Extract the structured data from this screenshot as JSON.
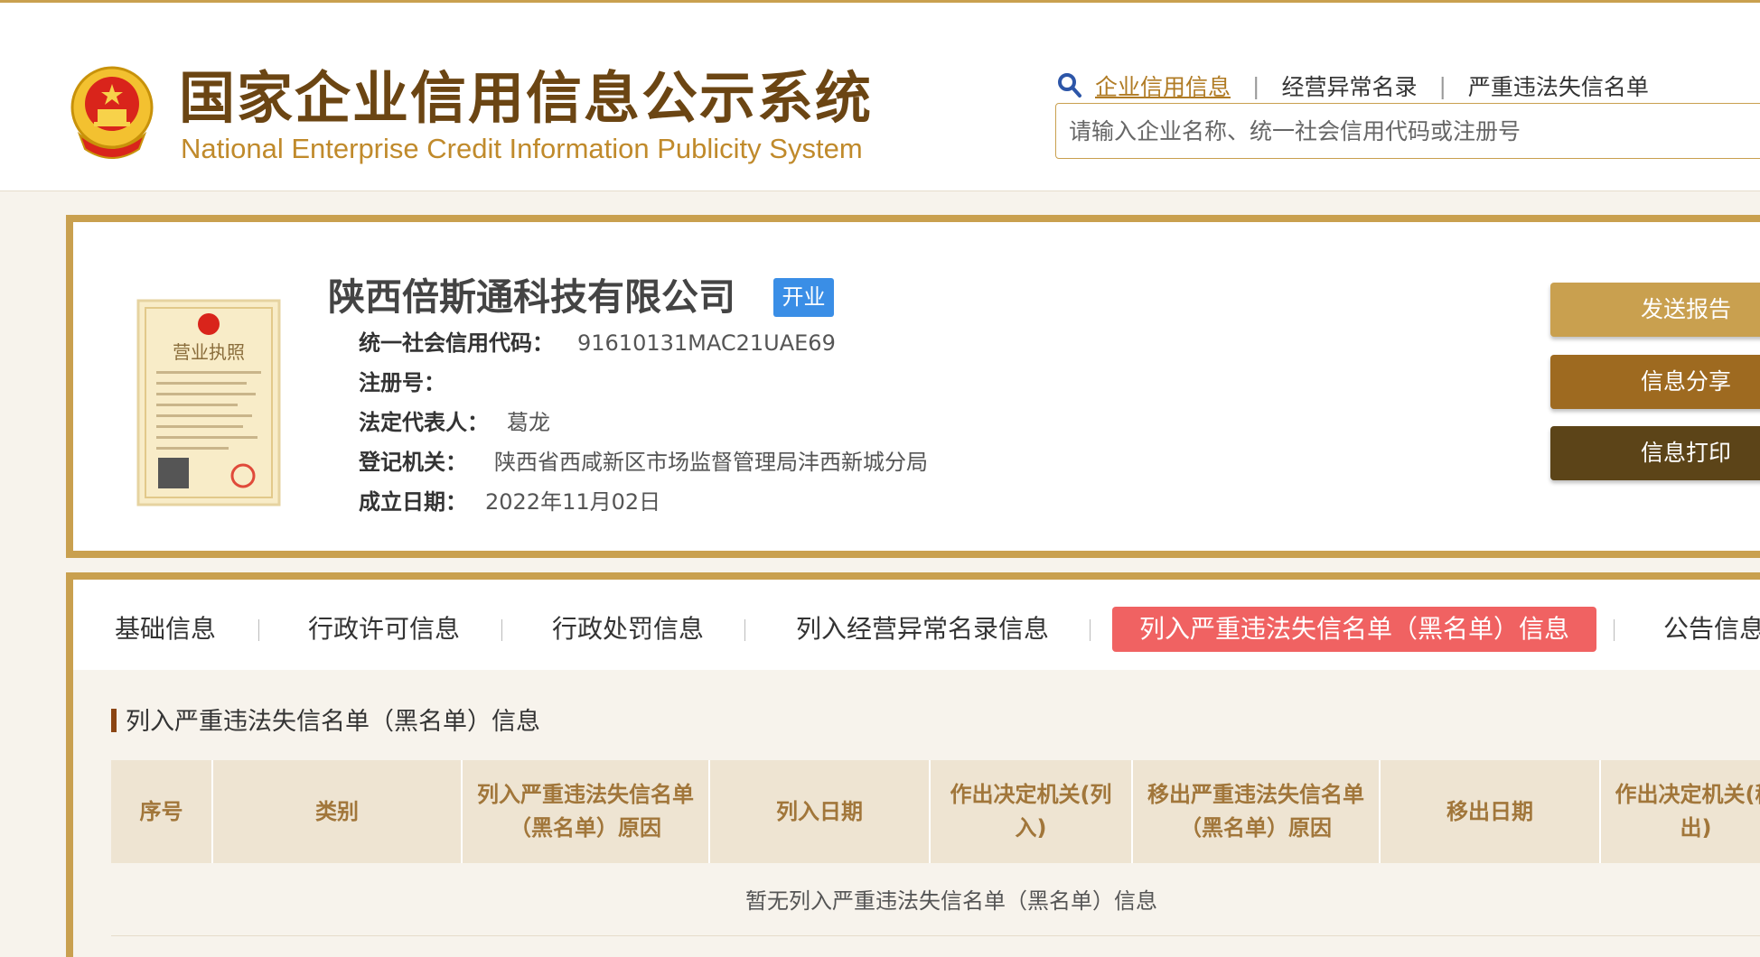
{
  "site": {
    "title_cn": "国家企业信用信息公示系统",
    "title_en": "National Enterprise Credit Information Publicity System"
  },
  "search": {
    "nav": [
      "企业信用信息",
      "经营异常名录",
      "严重违法失信名单"
    ],
    "placeholder": "请输入企业名称、统一社会信用代码或注册号"
  },
  "company": {
    "name": "陕西倍斯通科技有限公司",
    "status": "开业",
    "license_title": "营业执照",
    "fields": [
      {
        "label": "统一社会信用代码：",
        "value": "91610131MAC21UAE69"
      },
      {
        "label": "注册号：",
        "value": ""
      },
      {
        "label": "法定代表人：",
        "value": "葛龙"
      },
      {
        "label": "登记机关：",
        "value": "陕西省西咸新区市场监督管理局沣西新城分局"
      },
      {
        "label": "成立日期：",
        "value": "2022年11月02日"
      }
    ]
  },
  "actions": {
    "send_report": "发送报告",
    "share": "信息分享",
    "print": "信息打印"
  },
  "tabs": [
    "基础信息",
    "行政许可信息",
    "行政处罚信息",
    "列入经营异常名录信息",
    "列入严重违法失信名单（黑名单）信息",
    "公告信息"
  ],
  "section": {
    "title": "列入严重违法失信名单（黑名单）信息",
    "columns": [
      "序号",
      "类别",
      "列入严重违法失信名单（黑名单）原因",
      "列入日期",
      "作出决定机关(列入)",
      "移出严重违法失信名单（黑名单）原因",
      "移出日期",
      "作出决定机关(移出)"
    ],
    "empty_text": "暂无列入严重违法失信名单（黑名单）信息"
  },
  "colors": {
    "gold": "#c9a04f",
    "brown_dark": "#5c4418",
    "active_tab": "#f06262",
    "status_blue": "#3a8ee6"
  }
}
